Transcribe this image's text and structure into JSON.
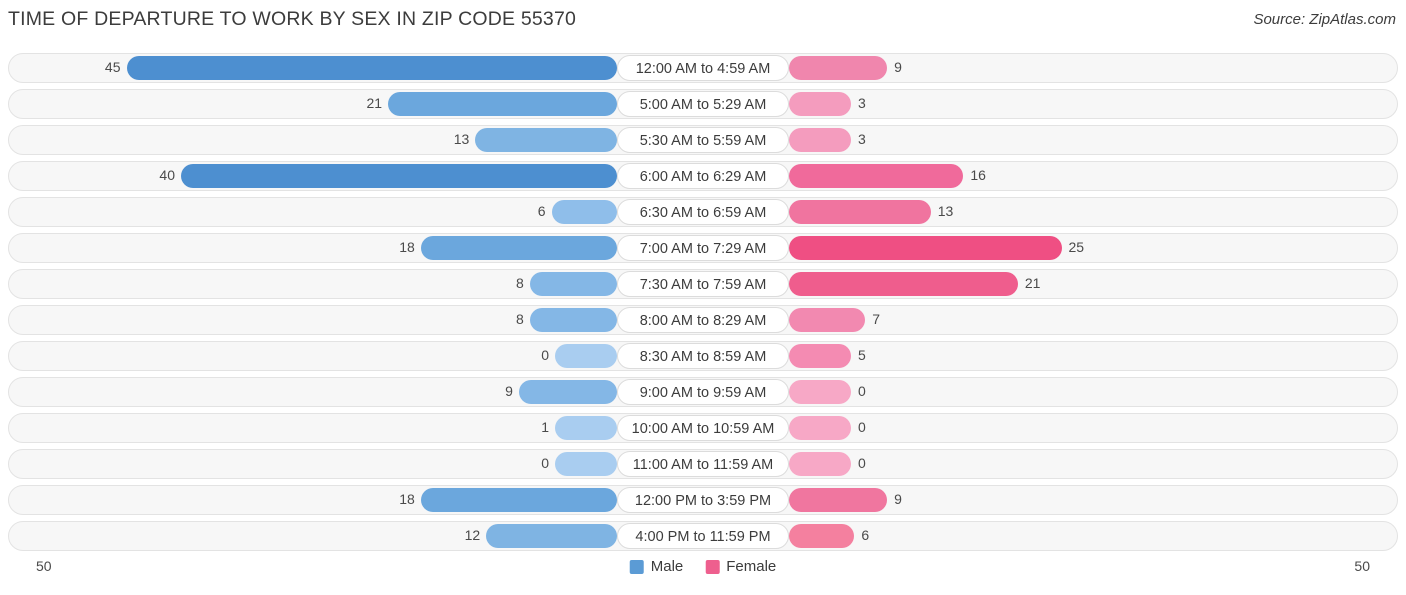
{
  "header": {
    "title": "TIME OF DEPARTURE TO WORK BY SEX IN ZIP CODE 55370",
    "source": "Source: ZipAtlas.com"
  },
  "legend": {
    "male_label": "Male",
    "female_label": "Female",
    "male_color": "#5b9bd5",
    "female_color": "#ee5f8e"
  },
  "axis": {
    "left_max": "50",
    "right_max": "50"
  },
  "chart_data": {
    "type": "bar",
    "orientation": "horizontal-diverging",
    "title": "TIME OF DEPARTURE TO WORK BY SEX IN ZIP CODE 55370",
    "xlabel": "",
    "ylabel": "",
    "xlim": [
      50,
      50
    ],
    "grid": false,
    "legend_position": "bottom-center",
    "categories": [
      "12:00 AM to 4:59 AM",
      "5:00 AM to 5:29 AM",
      "5:30 AM to 5:59 AM",
      "6:00 AM to 6:29 AM",
      "6:30 AM to 6:59 AM",
      "7:00 AM to 7:29 AM",
      "7:30 AM to 7:59 AM",
      "8:00 AM to 8:29 AM",
      "8:30 AM to 8:59 AM",
      "9:00 AM to 9:59 AM",
      "10:00 AM to 10:59 AM",
      "11:00 AM to 11:59 AM",
      "12:00 PM to 3:59 PM",
      "4:00 PM to 11:59 PM"
    ],
    "series": [
      {
        "name": "Male",
        "color": "#5b9bd5",
        "values": [
          45,
          21,
          13,
          40,
          6,
          18,
          8,
          8,
          0,
          9,
          1,
          0,
          18,
          12
        ]
      },
      {
        "name": "Female",
        "color": "#ee5f8e",
        "values": [
          9,
          3,
          3,
          16,
          13,
          25,
          21,
          7,
          5,
          0,
          0,
          0,
          9,
          6
        ]
      }
    ]
  },
  "rows": [
    {
      "category": "12:00 AM to 4:59 AM",
      "male": "45",
      "female": "9",
      "male_color": "#4d8fd0",
      "female_color": "#f086ad"
    },
    {
      "category": "5:00 AM to 5:29 AM",
      "male": "21",
      "female": "3",
      "male_color": "#6ba7dd",
      "female_color": "#f49cbe"
    },
    {
      "category": "5:30 AM to 5:59 AM",
      "male": "13",
      "female": "3",
      "male_color": "#7fb4e3",
      "female_color": "#f49cbe"
    },
    {
      "category": "6:00 AM to 6:29 AM",
      "male": "40",
      "female": "16",
      "male_color": "#4d8fd0",
      "female_color": "#f06a9b"
    },
    {
      "category": "6:30 AM to 6:59 AM",
      "male": "6",
      "female": "13",
      "male_color": "#8fbeea",
      "female_color": "#f0749f"
    },
    {
      "category": "7:00 AM to 7:29 AM",
      "male": "18",
      "female": "25",
      "male_color": "#6ba7dd",
      "female_color": "#ef4f83"
    },
    {
      "category": "7:30 AM to 7:59 AM",
      "male": "8",
      "female": "21",
      "male_color": "#84b7e6",
      "female_color": "#ef5d8d"
    },
    {
      "category": "8:00 AM to 8:29 AM",
      "male": "8",
      "female": "7",
      "male_color": "#84b7e6",
      "female_color": "#f289b0"
    },
    {
      "category": "8:30 AM to 8:59 AM",
      "male": "0",
      "female": "5",
      "male_color": "#a9cdf0",
      "female_color": "#f48bb2"
    },
    {
      "category": "9:00 AM to 9:59 AM",
      "male": "9",
      "female": "0",
      "male_color": "#84b7e6",
      "female_color": "#f7a8c6"
    },
    {
      "category": "10:00 AM to 10:59 AM",
      "male": "1",
      "female": "0",
      "male_color": "#a9cdf0",
      "female_color": "#f7a8c6"
    },
    {
      "category": "11:00 AM to 11:59 AM",
      "male": "0",
      "female": "0",
      "male_color": "#a9cdf0",
      "female_color": "#f7a8c6"
    },
    {
      "category": "12:00 PM to 3:59 PM",
      "male": "18",
      "female": "9",
      "male_color": "#6ba7dd",
      "female_color": "#f0769f"
    },
    {
      "category": "4:00 PM to 11:59 PM",
      "male": "12",
      "female": "6",
      "male_color": "#7fb4e3",
      "female_color": "#f4809f"
    }
  ]
}
